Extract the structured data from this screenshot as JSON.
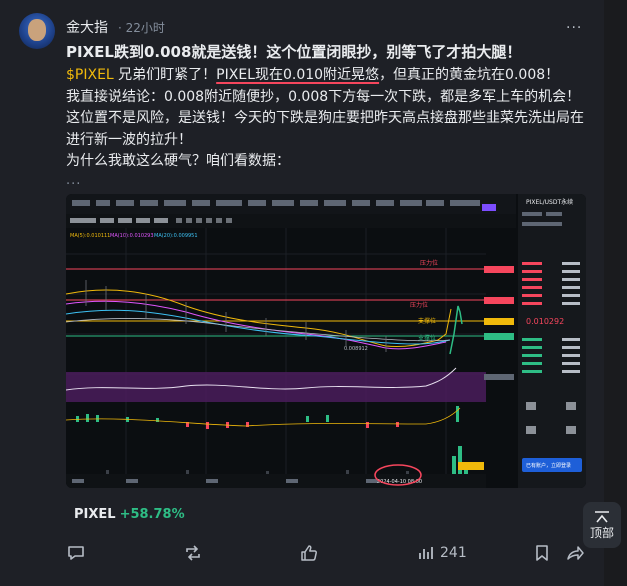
{
  "post": {
    "author": "金大指",
    "time": "· 22小时",
    "more": "···",
    "title": "PIXEL跌到0.008就是送钱！这个位置闭眼抄，别等飞了才拍大腿！",
    "line1_tag": "$PIXEL",
    "line1_a": " 兄弟们盯紧了！",
    "line1_underlined": "PIXEL现在0.010附近晃悠",
    "line1_b": "，但真正的黄金坑在0.008！",
    "line2": "我直接说结论：0.008附近随便抄，0.008下方每一次下跌，都是多军上车的机会！ 这位置不是风险，是送钱！今天的下跌是狗庄要把昨天高点接盘那些韭菜先洗出局在进行新一波的拉升！",
    "line3": "为什么我敢这么硬气？咱们看数据：",
    "ellipsis": "...",
    "coin_symbol": "PIXEL",
    "coin_change": "+58.78%"
  },
  "chart_screenshot": {
    "pair_title": "PIXEL/USDT永续",
    "ma_labels": [
      "MA(5):0.010111",
      "MA(10):0.010293",
      "MA(20):0.009951"
    ],
    "level_labels": [
      "压力位",
      "压力位",
      "支撑位",
      "支撑位"
    ],
    "price_tags": [
      "0.010292",
      "0.010004",
      "0.008912"
    ],
    "bottom_date": "2024-04-10 08:00",
    "order_labels": [
      "已有账户，立即登录"
    ]
  },
  "actions": {
    "comment_icon": "comment-icon",
    "repost_icon": "repost-icon",
    "like_icon": "like-icon",
    "views_icon": "views-icon",
    "views_count": "241",
    "bookmark_icon": "bookmark-icon",
    "share_icon": "share-icon"
  },
  "top_button": {
    "label": "顶部"
  }
}
